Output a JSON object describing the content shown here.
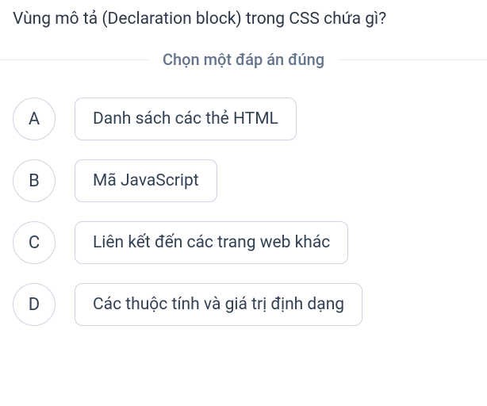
{
  "question": "Vùng mô tả (Declaration block) trong CSS chứa gì?",
  "instruction": "Chọn một đáp án đúng",
  "options": [
    {
      "letter": "A",
      "text": "Danh sách các thẻ HTML"
    },
    {
      "letter": "B",
      "text": "Mã JavaScript"
    },
    {
      "letter": "C",
      "text": "Liên kết đến các trang web khác"
    },
    {
      "letter": "D",
      "text": "Các thuộc tính và giá trị định dạng"
    }
  ]
}
